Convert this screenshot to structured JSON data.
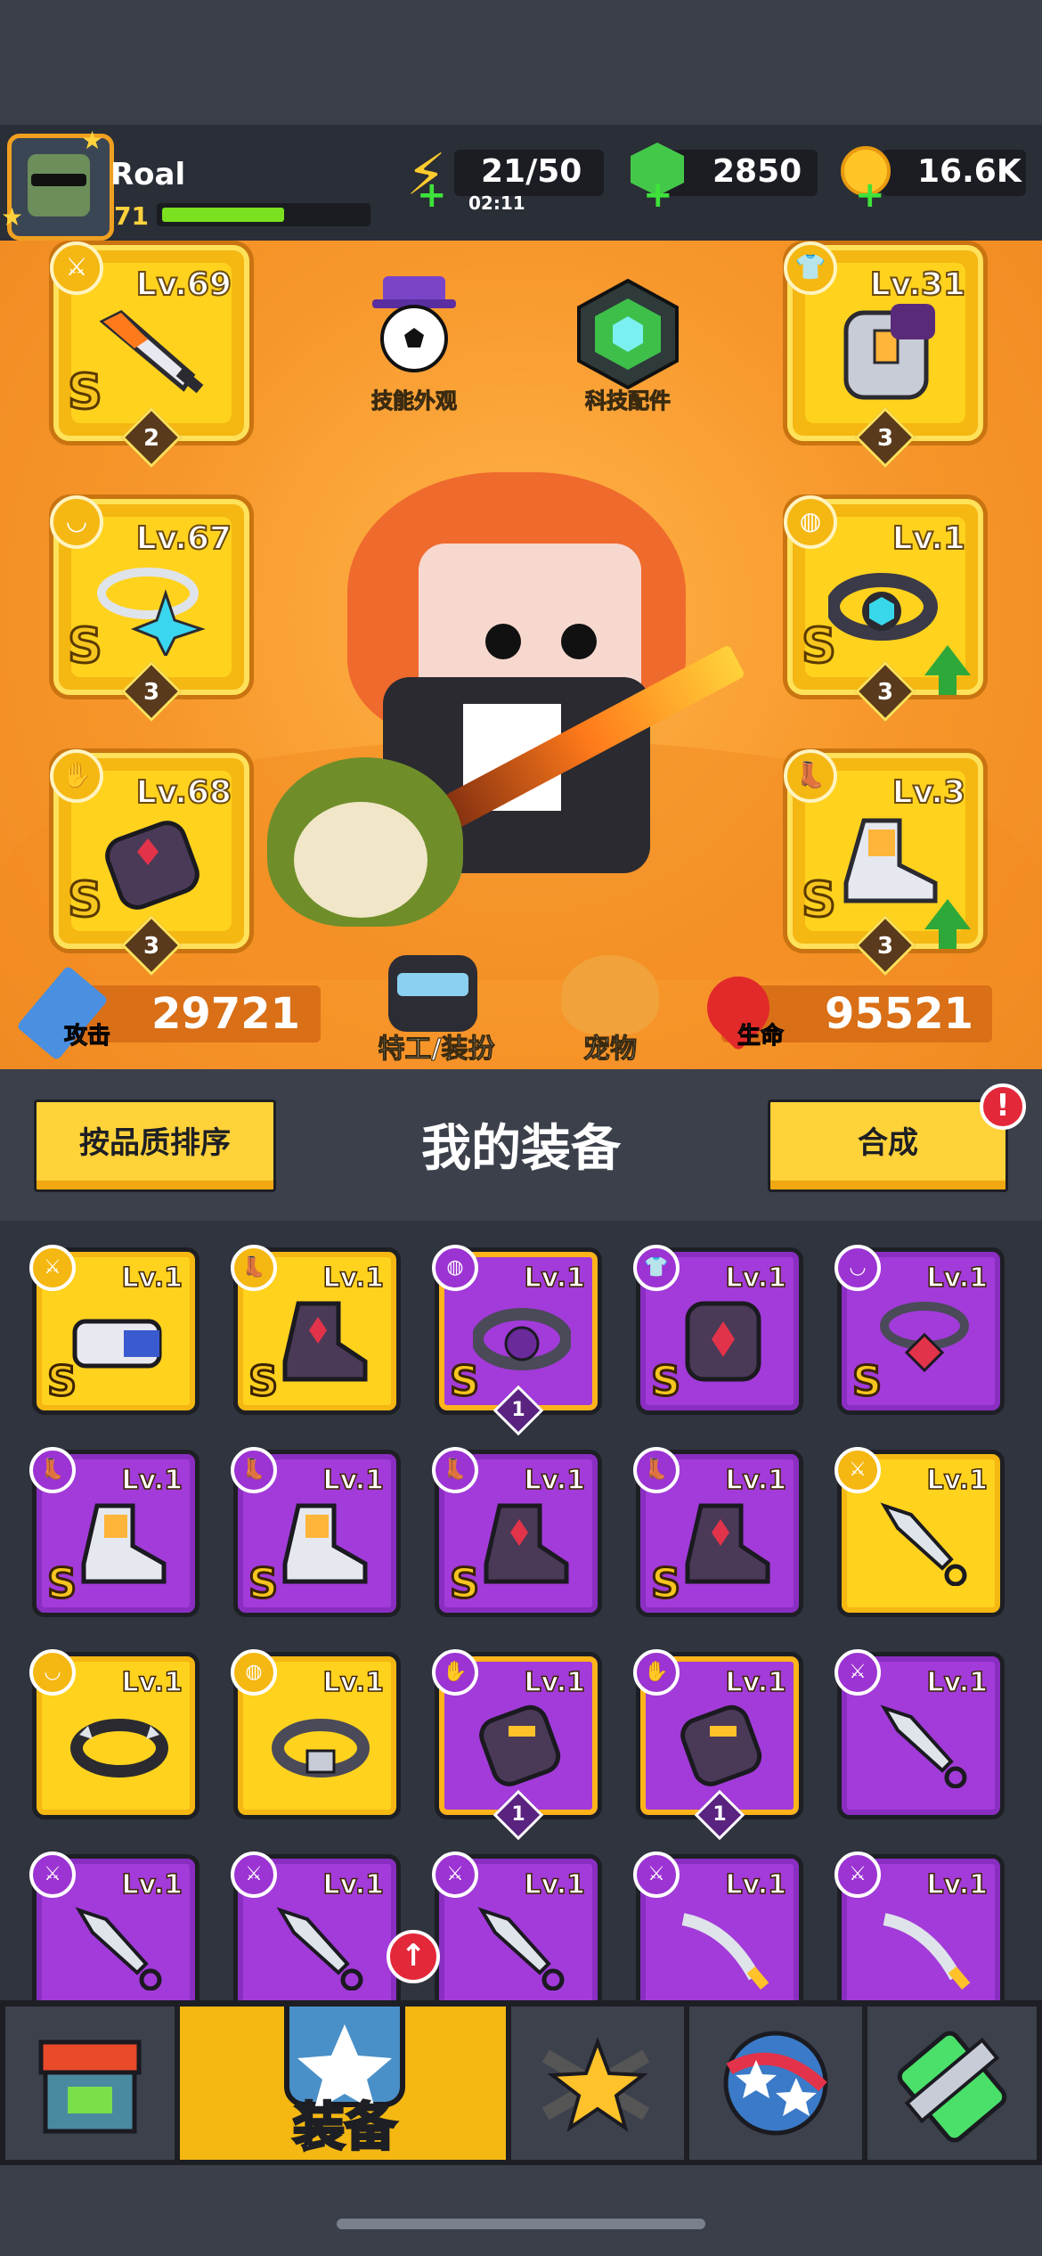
{
  "player": {
    "name": "Roal",
    "level": "71",
    "xp_fraction": 0.6
  },
  "resources": {
    "energy": "21/50",
    "energy_timer": "02:11",
    "gems": "2850",
    "coins": "16.6K"
  },
  "hero": {
    "skill_skin_label": "技能外观",
    "tech_parts_label": "科技配件",
    "agent_label": "特工/装扮",
    "pet_label": "宠物",
    "attack_label": "攻击",
    "attack_value": "29721",
    "hp_label": "生命",
    "hp_value": "95521"
  },
  "equipped": [
    {
      "slot": "weapon",
      "level": "Lv.69",
      "grade": "S",
      "count": "2",
      "upgrade": false,
      "icon": "kunai-icon"
    },
    {
      "slot": "armor",
      "level": "Lv.31",
      "grade": "",
      "count": "3",
      "upgrade": false,
      "icon": "shirt-icon"
    },
    {
      "slot": "necklace",
      "level": "Lv.67",
      "grade": "S",
      "count": "3",
      "upgrade": false,
      "icon": "necklace-icon"
    },
    {
      "slot": "belt",
      "level": "Lv.1",
      "grade": "S",
      "count": "3",
      "upgrade": true,
      "icon": "belt-icon"
    },
    {
      "slot": "gloves",
      "level": "Lv.68",
      "grade": "S",
      "count": "3",
      "upgrade": false,
      "icon": "glove-icon"
    },
    {
      "slot": "boots",
      "level": "Lv.3",
      "grade": "S",
      "count": "3",
      "upgrade": true,
      "icon": "boot-icon"
    }
  ],
  "equipment_panel": {
    "sort_label": "按品质排序",
    "title": "我的装备",
    "craft_label": "合成",
    "craft_alert": "!"
  },
  "inventory": [
    {
      "rarity": "gold",
      "level": "Lv.1",
      "grade": "S",
      "count": "",
      "icon": "kunai-icon",
      "art": "gun"
    },
    {
      "rarity": "gold",
      "level": "Lv.1",
      "grade": "S",
      "count": "",
      "icon": "boot-icon",
      "art": "boot"
    },
    {
      "rarity": "purple-hl",
      "level": "Lv.1",
      "grade": "S",
      "count": "1",
      "icon": "belt-icon",
      "art": "belt"
    },
    {
      "rarity": "purple",
      "level": "Lv.1",
      "grade": "S",
      "count": "",
      "icon": "shirt-icon",
      "art": "armor"
    },
    {
      "rarity": "purple",
      "level": "Lv.1",
      "grade": "S",
      "count": "",
      "icon": "necklace-icon",
      "art": "necklace"
    },
    {
      "rarity": "purple",
      "level": "Lv.1",
      "grade": "S",
      "count": "",
      "icon": "boot-icon",
      "art": "shoe"
    },
    {
      "rarity": "purple",
      "level": "Lv.1",
      "grade": "S",
      "count": "",
      "icon": "boot-icon",
      "art": "shoe"
    },
    {
      "rarity": "purple",
      "level": "Lv.1",
      "grade": "S",
      "count": "",
      "icon": "boot-icon",
      "art": "boot"
    },
    {
      "rarity": "purple",
      "level": "Lv.1",
      "grade": "S",
      "count": "",
      "icon": "boot-icon",
      "art": "boot"
    },
    {
      "rarity": "gold",
      "level": "Lv.1",
      "grade": "",
      "count": "",
      "icon": "kunai-icon",
      "art": "kunai"
    },
    {
      "rarity": "gold",
      "level": "Lv.1",
      "grade": "",
      "count": "",
      "icon": "necklace-icon",
      "art": "collar"
    },
    {
      "rarity": "gold",
      "level": "Lv.1",
      "grade": "",
      "count": "",
      "icon": "belt-icon",
      "art": "beltgold"
    },
    {
      "rarity": "purple-hl",
      "level": "Lv.1",
      "grade": "",
      "count": "1",
      "icon": "glove-icon",
      "art": "glove"
    },
    {
      "rarity": "purple-hl",
      "level": "Lv.1",
      "grade": "",
      "count": "1",
      "icon": "glove-icon",
      "art": "glove"
    },
    {
      "rarity": "purple",
      "level": "Lv.1",
      "grade": "",
      "count": "",
      "icon": "kunai-icon",
      "art": "kunai"
    },
    {
      "rarity": "purple",
      "level": "Lv.1",
      "grade": "",
      "count": "",
      "icon": "kunai-icon",
      "art": "kunai"
    },
    {
      "rarity": "purple",
      "level": "Lv.1",
      "grade": "",
      "count": "",
      "icon": "kunai-icon",
      "art": "kunai"
    },
    {
      "rarity": "purple",
      "level": "Lv.1",
      "grade": "",
      "count": "",
      "icon": "kunai-icon",
      "art": "kunai"
    },
    {
      "rarity": "purple",
      "level": "Lv.1",
      "grade": "",
      "count": "",
      "icon": "kunai-icon",
      "art": "katana"
    },
    {
      "rarity": "purple",
      "level": "Lv.1",
      "grade": "",
      "count": "",
      "icon": "kunai-icon",
      "art": "katana"
    }
  ],
  "nav": {
    "active_label": "装备",
    "alert": "↑",
    "tabs": [
      "shop-icon",
      "equipment-icon",
      "battle-icon",
      "skills-icon",
      "lab-icon"
    ]
  },
  "colors": {
    "gold": "#ffd21e",
    "purple": "#a23bd9",
    "orange_bg": "#f7962a",
    "panel": "#3b404b"
  }
}
